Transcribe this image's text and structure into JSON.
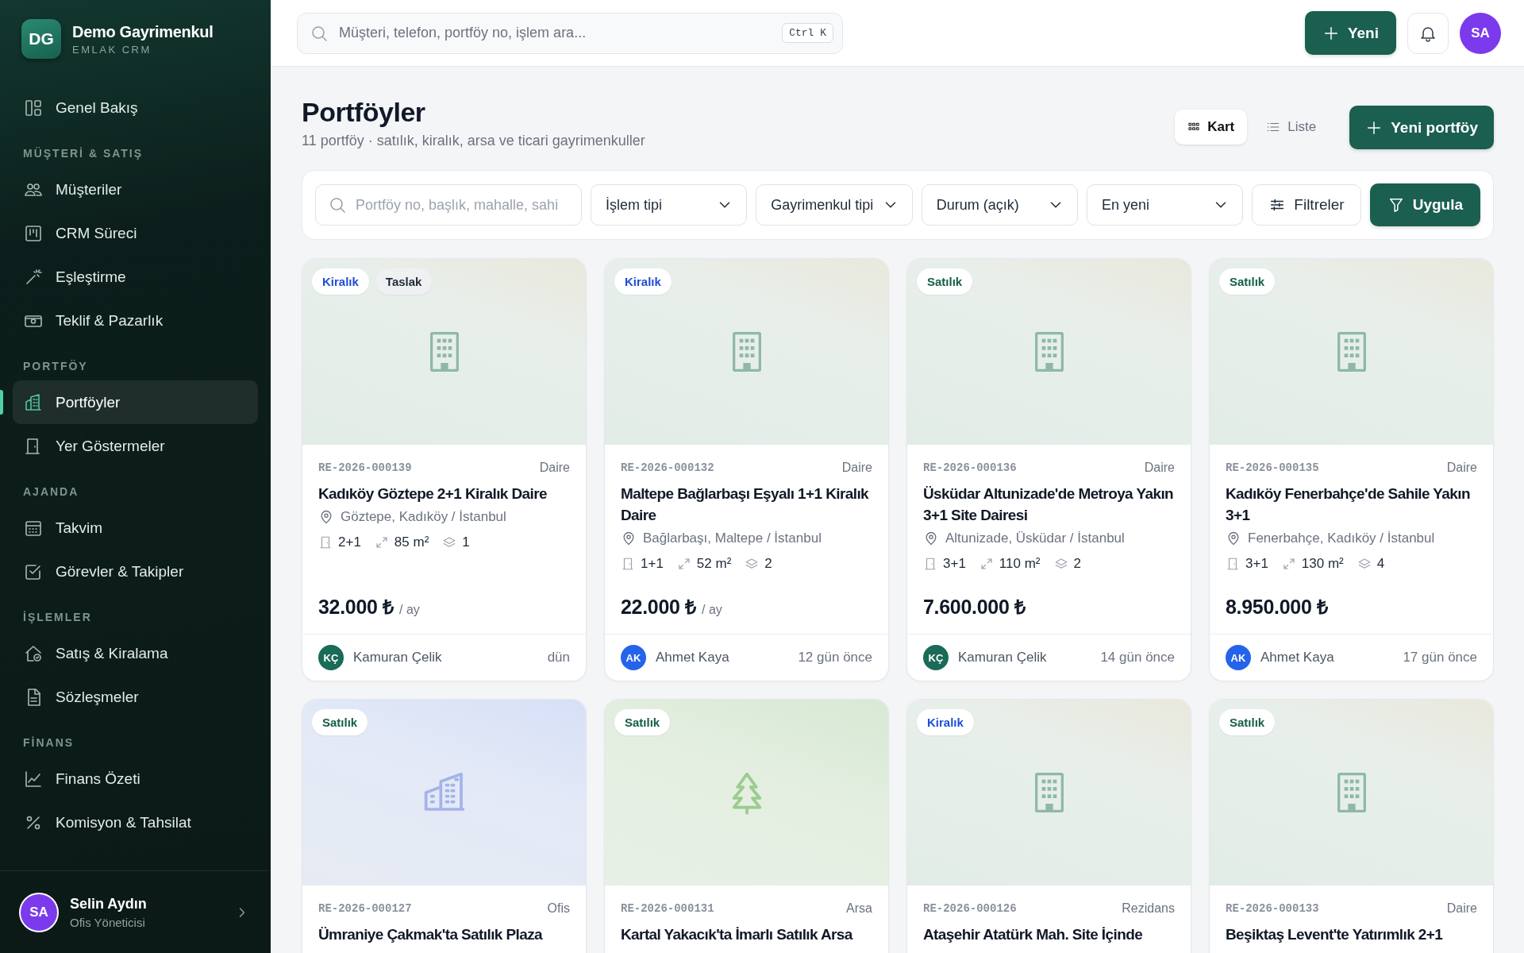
{
  "brand": {
    "initials": "DG",
    "name": "Demo Gayrimenkul",
    "subtitle": "EMLAK CRM"
  },
  "sidebar": {
    "sections": [
      {
        "items": [
          {
            "label": "Genel Bakış",
            "selected": false
          }
        ]
      },
      {
        "title": "MÜŞTERİ & SATIŞ",
        "items": [
          {
            "label": "Müşteriler",
            "selected": false
          },
          {
            "label": "CRM Süreci",
            "selected": false
          },
          {
            "label": "Eşleştirme",
            "selected": false
          },
          {
            "label": "Teklif & Pazarlık",
            "selected": false
          }
        ]
      },
      {
        "title": "PORTFÖY",
        "items": [
          {
            "label": "Portföyler",
            "selected": true
          },
          {
            "label": "Yer Göstermeler",
            "selected": false
          }
        ]
      },
      {
        "title": "AJANDA",
        "items": [
          {
            "label": "Takvim",
            "selected": false
          },
          {
            "label": "Görevler & Takipler",
            "selected": false
          }
        ]
      },
      {
        "title": "İŞLEMLER",
        "items": [
          {
            "label": "Satış & Kiralama",
            "selected": false
          },
          {
            "label": "Sözleşmeler",
            "selected": false
          }
        ]
      },
      {
        "title": "FİNANS",
        "items": [
          {
            "label": "Finans Özeti",
            "selected": false
          },
          {
            "label": "Komisyon & Tahsilat",
            "selected": false
          }
        ]
      }
    ],
    "user": {
      "initials": "SA",
      "name": "Selin Aydın",
      "role": "Ofis Yöneticisi"
    }
  },
  "topbar": {
    "search": {
      "placeholder": "Müşteri, telefon, portföy no, işlem ara..."
    },
    "shortcut": "Ctrl K",
    "new_button": "Yeni",
    "avatar": "SA"
  },
  "header": {
    "title": "Portföyler",
    "subtitle": "11 portföy · satılık, kiralık, arsa ve ticari gayrimenkuller",
    "views": [
      {
        "label": "Kart",
        "selected": true
      },
      {
        "label": "Liste",
        "selected": false
      }
    ],
    "new_button": "Yeni portföy"
  },
  "filters": {
    "search": {
      "placeholder": "Portföy no, başlık, mahalle, sahi"
    },
    "selects": [
      "İşlem tipi",
      "Gayrimenkul tipi",
      "Durum (açık)",
      "En yeni"
    ],
    "more_button": "Filtreler",
    "apply_button": "Uygula"
  },
  "cards": [
    {
      "image": {
        "kind": "building"
      },
      "tags": [
        {
          "label": "Kiralık",
          "kind": "rent"
        },
        {
          "label": "Taslak",
          "kind": "draft"
        }
      ],
      "code": "RE-2026-000139",
      "type": "Daire",
      "title": "Kadıköy Göztepe 2+1 Kiralık Daire",
      "location": "Göztepe, Kadıköy / İstanbul",
      "rooms": "2+1",
      "area": "85 m²",
      "floor": "1",
      "price": "32.000 ₺",
      "period": "/ ay",
      "agent": {
        "initials": "KÇ",
        "name": "Kamuran Çelik",
        "color": "#1a6b58"
      },
      "time": "dün"
    },
    {
      "image": {
        "kind": "building"
      },
      "tags": [
        {
          "label": "Kiralık",
          "kind": "rent"
        }
      ],
      "code": "RE-2026-000132",
      "type": "Daire",
      "title": "Maltepe Bağlarbaşı Eşyalı 1+1 Kiralık Daire",
      "location": "Bağlarbaşı, Maltepe / İstanbul",
      "rooms": "1+1",
      "area": "52 m²",
      "floor": "2",
      "price": "22.000 ₺",
      "period": "/ ay",
      "agent": {
        "initials": "AK",
        "name": "Ahmet Kaya",
        "color": "#2563eb"
      },
      "time": "12 gün önce"
    },
    {
      "image": {
        "kind": "building"
      },
      "tags": [
        {
          "label": "Satılık",
          "kind": "sale"
        }
      ],
      "code": "RE-2026-000136",
      "type": "Daire",
      "title": "Üsküdar Altunizade'de Metroya Yakın 3+1 Site Dairesi",
      "location": "Altunizade, Üsküdar / İstanbul",
      "rooms": "3+1",
      "area": "110 m²",
      "floor": "2",
      "price": "7.600.000 ₺",
      "agent": {
        "initials": "KÇ",
        "name": "Kamuran Çelik",
        "color": "#1a6b58"
      },
      "time": "14 gün önce"
    },
    {
      "image": {
        "kind": "building"
      },
      "tags": [
        {
          "label": "Satılık",
          "kind": "sale"
        }
      ],
      "code": "RE-2026-000135",
      "type": "Daire",
      "title": "Kadıköy Fenerbahçe'de Sahile Yakın 3+1",
      "location": "Fenerbahçe, Kadıköy / İstanbul",
      "rooms": "3+1",
      "area": "130 m²",
      "floor": "4",
      "price": "8.950.000 ₺",
      "agent": {
        "initials": "AK",
        "name": "Ahmet Kaya",
        "color": "#2563eb"
      },
      "time": "17 gün önce"
    },
    {
      "image": {
        "kind": "office"
      },
      "tags": [
        {
          "label": "Satılık",
          "kind": "sale"
        }
      ],
      "code": "RE-2026-000127",
      "type": "Ofis",
      "title": "Ümraniye Çakmak'ta Satılık Plaza"
    },
    {
      "image": {
        "kind": "land"
      },
      "tags": [
        {
          "label": "Satılık",
          "kind": "sale"
        }
      ],
      "code": "RE-2026-000131",
      "type": "Arsa",
      "title": "Kartal Yakacık'ta İmarlı Satılık Arsa"
    },
    {
      "image": {
        "kind": "building"
      },
      "tags": [
        {
          "label": "Kiralık",
          "kind": "rent"
        }
      ],
      "code": "RE-2026-000126",
      "type": "Rezidans",
      "title": "Ataşehir Atatürk Mah. Site İçinde"
    },
    {
      "image": {
        "kind": "building"
      },
      "tags": [
        {
          "label": "Satılık",
          "kind": "sale"
        }
      ],
      "code": "RE-2026-000133",
      "type": "Daire",
      "title": "Beşiktaş Levent'te Yatırımlık 2+1"
    }
  ]
}
